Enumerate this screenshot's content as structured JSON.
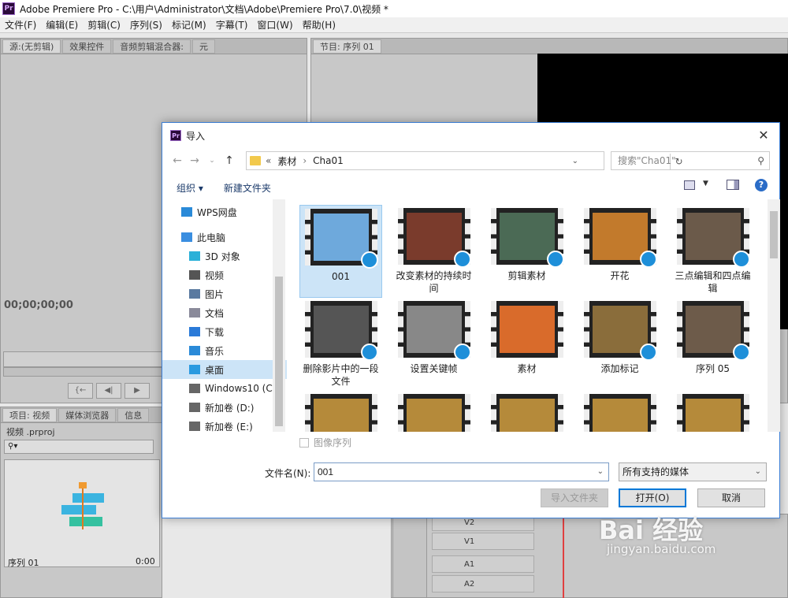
{
  "window": {
    "title": "Adobe Premiere Pro - C:\\用户\\Administrator\\文档\\Adobe\\Premiere Pro\\7.0\\视频 *",
    "logo_text": "Pr"
  },
  "menu": [
    "文件(F)",
    "编辑(E)",
    "剪辑(C)",
    "序列(S)",
    "标记(M)",
    "字幕(T)",
    "窗口(W)",
    "帮助(H)"
  ],
  "source_panel": {
    "tabs": [
      "源:(无剪辑)",
      "效果控件",
      "音频剪辑混合器:",
      "元"
    ],
    "timecode": "00;00;00;00"
  },
  "program_panel": {
    "tab": "节目: 序列 01"
  },
  "project_panel": {
    "tabs": [
      "项目: 视频",
      "媒体浏览器",
      "信息"
    ],
    "project_file": "视频 .prproj",
    "sequence_name": "序列 01",
    "sequence_duration": "0:00"
  },
  "timeline": {
    "tracks": [
      "V2",
      "V1",
      "A1",
      "A2"
    ]
  },
  "dialog": {
    "title": "导入",
    "breadcrumb": {
      "prefix": "«",
      "parts": [
        "素材",
        "Cha01"
      ]
    },
    "search_placeholder": "搜索\"Cha01\"",
    "organize_label": "组织 ▾",
    "new_folder_label": "新建文件夹",
    "nav": [
      {
        "label": "WPS网盘",
        "icon": "cloud-icon",
        "level": "top"
      },
      {
        "label": "此电脑",
        "icon": "computer-icon",
        "level": "top"
      },
      {
        "label": "3D 对象",
        "icon": "cube-icon",
        "level": "sub"
      },
      {
        "label": "视频",
        "icon": "video-icon",
        "level": "sub"
      },
      {
        "label": "图片",
        "icon": "picture-icon",
        "level": "sub"
      },
      {
        "label": "文档",
        "icon": "document-icon",
        "level": "sub"
      },
      {
        "label": "下载",
        "icon": "download-icon",
        "level": "sub"
      },
      {
        "label": "音乐",
        "icon": "music-icon",
        "level": "sub"
      },
      {
        "label": "桌面",
        "icon": "desktop-icon",
        "level": "sub",
        "selected": true
      },
      {
        "label": "Windows10 (C:",
        "icon": "drive-icon",
        "level": "sub"
      },
      {
        "label": "新加卷 (D:)",
        "icon": "drive-icon",
        "level": "sub"
      },
      {
        "label": "新加卷 (E:)",
        "icon": "drive-icon",
        "level": "sub"
      }
    ],
    "files": [
      {
        "name": "001",
        "thumb": "#6ea9dc",
        "selected": true
      },
      {
        "name": "改变素材的持续时间",
        "thumb": "#7a3b2c"
      },
      {
        "name": "剪辑素材",
        "thumb": "#4b6a55"
      },
      {
        "name": "开花",
        "thumb": "#c27a2c"
      },
      {
        "name": "三点编辑和四点编辑",
        "thumb": "#6b5a4a"
      },
      {
        "name": "删除影片中的一段文件",
        "thumb": "#555555"
      },
      {
        "name": "设置关键帧",
        "thumb": "#888888"
      },
      {
        "name": "素材",
        "thumb": "#d96b2b"
      },
      {
        "name": "添加标记",
        "thumb": "#8a6d3b"
      },
      {
        "name": "序列 05",
        "thumb": "#6d5b4a"
      },
      {
        "name": "",
        "thumb": "#b58a3a"
      },
      {
        "name": "",
        "thumb": "#b58a3a"
      },
      {
        "name": "",
        "thumb": "#b58a3a"
      },
      {
        "name": "",
        "thumb": "#b58a3a"
      },
      {
        "name": "",
        "thumb": "#b58a3a"
      }
    ],
    "image_sequence_label": "图像序列",
    "filename_label": "文件名(N):",
    "filename_value": "001",
    "filter_value": "所有支持的媒体",
    "import_folder_label": "导入文件夹",
    "open_label": "打开(O)",
    "cancel_label": "取消"
  },
  "watermark": {
    "brand": "Bai 经验",
    "url": "jingyan.baidu.com"
  }
}
